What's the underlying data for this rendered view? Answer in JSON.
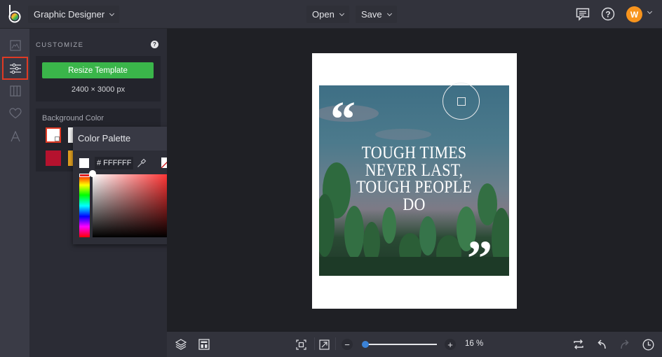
{
  "topbar": {
    "app_mode": "Graphic Designer",
    "open_label": "Open",
    "save_label": "Save",
    "avatar_initial": "W",
    "icons": [
      "logo",
      "chat-icon",
      "help-icon",
      "avatar",
      "chevron-down-icon"
    ]
  },
  "rail": {
    "items": [
      {
        "name": "image",
        "icon": "image-icon",
        "active": false
      },
      {
        "name": "customize",
        "icon": "sliders-icon",
        "active": true
      },
      {
        "name": "layouts",
        "icon": "columns-icon",
        "active": false
      },
      {
        "name": "graphics",
        "icon": "heart-icon",
        "active": false
      },
      {
        "name": "text",
        "icon": "text-icon",
        "active": false
      }
    ]
  },
  "panel": {
    "title": "CUSTOMIZE",
    "help": "?",
    "resize_label": "Resize Template",
    "dimensions": "2400 × 3000 px",
    "background_label": "Background Color",
    "swatches": [
      {
        "color": "#FFFFFF",
        "selected": true
      },
      {
        "color": "#F2F2F2",
        "selected": false
      },
      {
        "color": "#B5122E",
        "selected": false
      },
      {
        "color": "#E0A020",
        "selected": false
      }
    ]
  },
  "color_palette": {
    "title": "Color Palette",
    "hex_value": "# FFFFFF",
    "current_color": "#FFFFFF",
    "hue_color": "#FF0000"
  },
  "canvas": {
    "quote_lines": [
      "TOUGH TIMES",
      "NEVER LAST,",
      "TOUGH PEOPLE",
      "DO"
    ],
    "open_quote": "“",
    "close_quote": "”"
  },
  "bottombar": {
    "zoom_percent": 16,
    "zoom_label": "16 %",
    "minus": "−",
    "plus": "+"
  },
  "colors": {
    "accent_green": "#3AB54A",
    "active_red": "#E03A24",
    "avatar_orange": "#F7941D",
    "slider_blue": "#3B82D6"
  }
}
